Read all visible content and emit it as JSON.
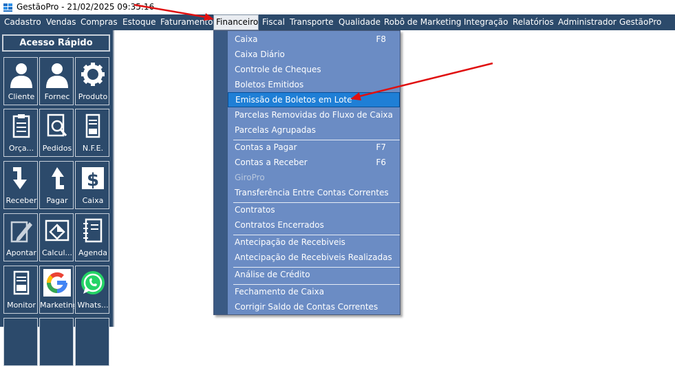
{
  "window": {
    "title": "GestãoPro - 21/02/2025 09:35:16",
    "logo_icon": "app-logo-icon"
  },
  "menubar": {
    "items": [
      {
        "label": "Cadastro"
      },
      {
        "label": "Vendas"
      },
      {
        "label": "Compras"
      },
      {
        "label": "Estoque"
      },
      {
        "label": "Faturamento"
      },
      {
        "label": "Financeiro",
        "active": true
      },
      {
        "label": "Fiscal"
      },
      {
        "label": "Transporte"
      },
      {
        "label": "Qualidade"
      },
      {
        "label": "Robô de Marketing"
      },
      {
        "label": "Integração"
      },
      {
        "label": "Relatórios"
      },
      {
        "label": "Administrador"
      },
      {
        "label": "GestãoPro"
      }
    ]
  },
  "quick_access": {
    "title": "Acesso Rápido",
    "buttons": [
      {
        "label": "Cliente",
        "icon": "person-icon"
      },
      {
        "label": "Fornec",
        "icon": "person-icon"
      },
      {
        "label": "Produto",
        "icon": "gear-icon"
      },
      {
        "label": "Orça...",
        "icon": "clipboard-icon"
      },
      {
        "label": "Pedidos",
        "icon": "search-document-icon"
      },
      {
        "label": "N.F.E.",
        "icon": "invoice-icon"
      },
      {
        "label": "Receber",
        "icon": "arrow-down-icon"
      },
      {
        "label": "Pagar",
        "icon": "arrow-up-icon"
      },
      {
        "label": "Caixa",
        "icon": "dollar-icon"
      },
      {
        "label": "Apontar",
        "icon": "pencil-clipboard-icon"
      },
      {
        "label": "Calcul...",
        "icon": "calculator-icon"
      },
      {
        "label": "Agenda",
        "icon": "notebook-icon"
      },
      {
        "label": "Monitor",
        "icon": "monitor-icon"
      },
      {
        "label": "Marketing",
        "icon": "google-icon"
      },
      {
        "label": "Whats...",
        "icon": "whatsapp-icon"
      }
    ]
  },
  "financeiro_menu": {
    "items": [
      {
        "label": "Caixa",
        "shortcut": "F8"
      },
      {
        "label": "Caixa Diário",
        "shortcut": ""
      },
      {
        "label": "Controle de Cheques",
        "shortcut": ""
      },
      {
        "label": "Boletos Emitidos",
        "shortcut": ""
      },
      {
        "label": "Emissão de Boletos em Lote",
        "shortcut": "",
        "highlighted": true
      },
      {
        "label": "Parcelas Removidas do Fluxo de Caixa",
        "shortcut": ""
      },
      {
        "label": "Parcelas Agrupadas",
        "shortcut": ""
      },
      {
        "label": "Contas a Pagar",
        "shortcut": "F7"
      },
      {
        "label": "Contas a Receber",
        "shortcut": "F6"
      },
      {
        "label": "GiroPro",
        "shortcut": "",
        "disabled": true
      },
      {
        "label": "Transferência Entre Contas Correntes",
        "shortcut": ""
      },
      {
        "label": "Contratos",
        "shortcut": ""
      },
      {
        "label": "Contratos Encerrados",
        "shortcut": ""
      },
      {
        "label": "Antecipação de Recebiveis",
        "shortcut": ""
      },
      {
        "label": "Antecipação de Recebiveis Realizadas",
        "shortcut": ""
      },
      {
        "label": "Análise de Crédito",
        "shortcut": ""
      },
      {
        "label": "Fechamento de Caixa",
        "shortcut": ""
      },
      {
        "label": "Corrigir Saldo de Contas Correntes",
        "shortcut": ""
      }
    ]
  },
  "annotation_color": "#e01010"
}
